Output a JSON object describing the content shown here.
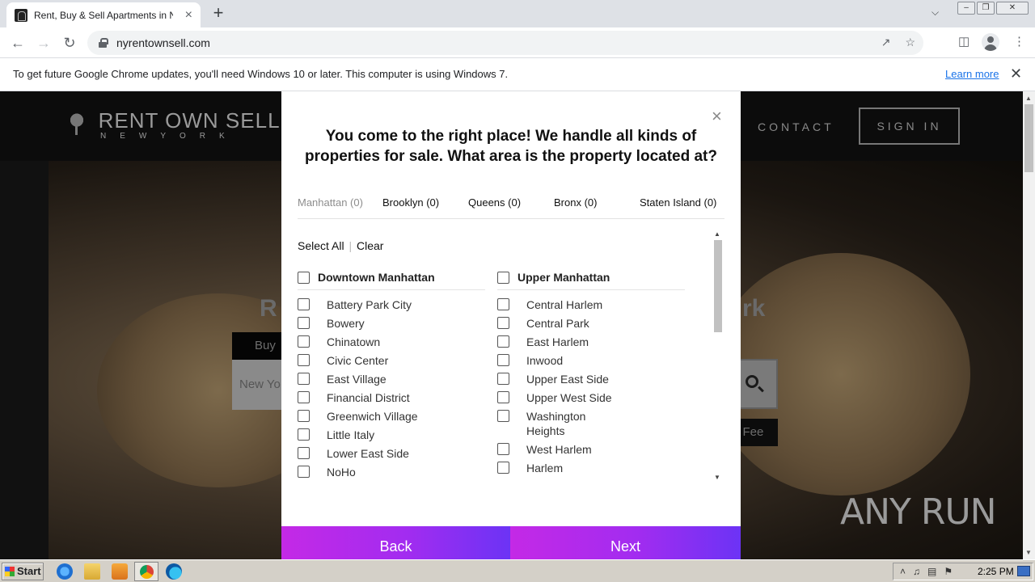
{
  "browser": {
    "tab_title": "Rent, Buy & Sell Apartments in New",
    "url": "nyrentownsell.com"
  },
  "infobar": {
    "message": "To get future Google Chrome updates, you'll need Windows 10 or later. This computer is using Windows 7.",
    "link": "Learn more"
  },
  "site": {
    "logo_main": "RENT OWN SELL",
    "logo_sub": "NEWYORK",
    "nav_contact": "CONTACT",
    "nav_signin": "SIGN IN",
    "hero_left": "R",
    "hero_right": "rk",
    "hero_tab": "Buy",
    "hero_search_placeholder": "New Yo",
    "hero_nofee": "o Fee"
  },
  "modal": {
    "title": "You come to the right place! We handle all kinds of properties for sale. What area is the property located at?",
    "tabs": [
      {
        "label": "Manhattan (0)",
        "active": true
      },
      {
        "label": "Brooklyn (0)",
        "active": false
      },
      {
        "label": "Queens (0)",
        "active": false
      },
      {
        "label": "Bronx (0)",
        "active": false
      },
      {
        "label": "Staten Island (0)",
        "active": false
      }
    ],
    "select_all": "Select All",
    "clear": "Clear",
    "groups": [
      {
        "title": "Downtown Manhattan",
        "items": [
          "Battery Park City",
          "Bowery",
          "Chinatown",
          "Civic Center",
          "East Village",
          "Financial District",
          "Greenwich Village",
          "Little Italy",
          "Lower East Side",
          "NoHo"
        ]
      },
      {
        "title": "Upper Manhattan",
        "items": [
          "Central Harlem",
          "Central Park",
          "East Harlem",
          "Inwood",
          "Upper East Side",
          "Upper West Side",
          "Washington Heights",
          "West Harlem",
          "Harlem"
        ]
      }
    ],
    "back_label": "Back",
    "next_label": "Next"
  },
  "watermark": "ANY RUN",
  "taskbar": {
    "start_label": "Start",
    "clock": "2:25 PM"
  }
}
